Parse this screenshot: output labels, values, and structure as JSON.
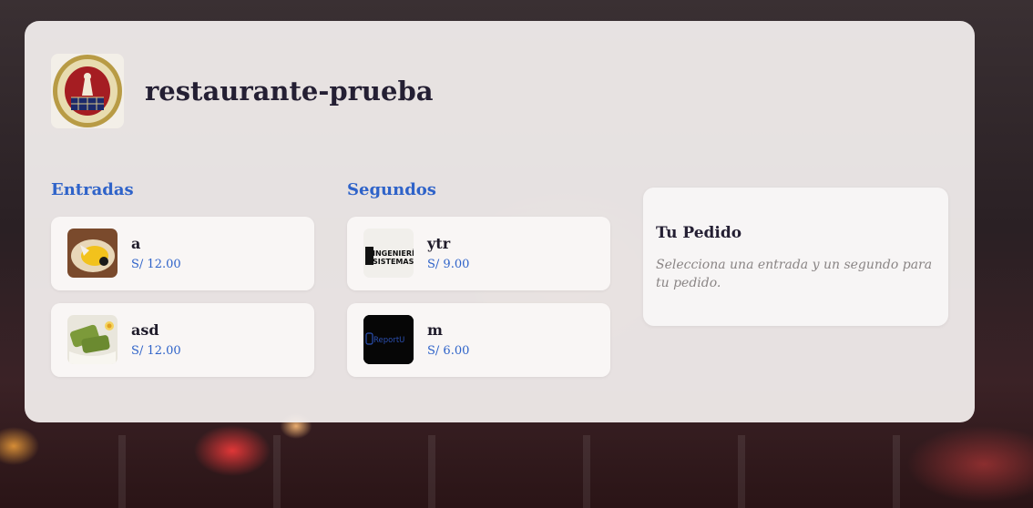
{
  "restaurant": {
    "name": "restaurante-prueba",
    "logo_icon": "university-seal-logo"
  },
  "menu": {
    "entradas": {
      "label": "Entradas",
      "items": [
        {
          "name": "a",
          "price": "S/ 12.00",
          "image_icon": "dish-photo"
        },
        {
          "name": "asd",
          "price": "S/ 12.00",
          "image_icon": "dish-photo"
        }
      ]
    },
    "segundos": {
      "label": "Segundos",
      "items": [
        {
          "name": "ytr",
          "price": "S/ 9.00",
          "image_icon": "ingenieria-sistemas-logo",
          "image_text_1": "INGENIERÍA",
          "image_text_2": "SISTEMAS"
        },
        {
          "name": "m",
          "price": "S/ 6.00",
          "image_icon": "reportu-logo",
          "image_text_1": "ReportU"
        }
      ]
    }
  },
  "order": {
    "title": "Tu Pedido",
    "hint": "Selecciona una entrada y un segundo para tu pedido."
  },
  "colors": {
    "accent": "#2f63c9",
    "title": "#241f33"
  }
}
